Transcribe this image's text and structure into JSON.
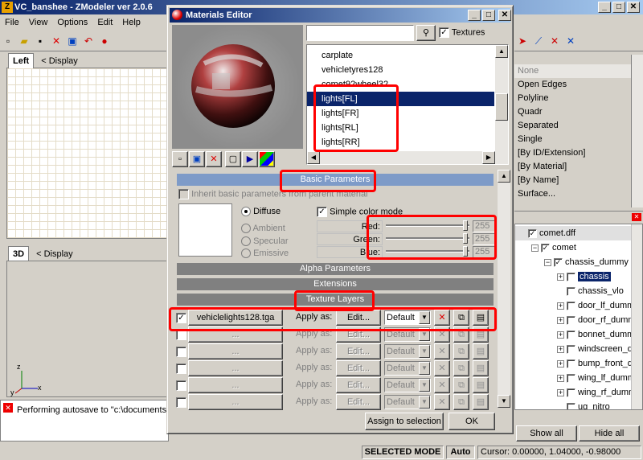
{
  "main_window": {
    "title": "VC_banshee - ZModeler ver 2.0.6",
    "app_icon": "Z"
  },
  "menu": [
    "File",
    "View",
    "Options",
    "Edit",
    "Help"
  ],
  "viewports": {
    "top": {
      "tab": "Left",
      "mode": "< Display"
    },
    "bottom": {
      "tab": "3D",
      "mode": "< Display"
    },
    "axis_z": "z",
    "axis_x": "x",
    "axis_y": "y"
  },
  "log": {
    "text": "Performing autosave to \"c:\\documents"
  },
  "dialog": {
    "title": "Materials Editor",
    "search_value": "",
    "textures_label": "Textures",
    "textures_checked": true,
    "materials": [
      {
        "name": "carplate",
        "selected": false
      },
      {
        "name": "vehicletyres128",
        "selected": false
      },
      {
        "name": "comet92wheel32",
        "selected": false
      },
      {
        "name": "lights[FL]",
        "selected": true
      },
      {
        "name": "lights[FR]",
        "selected": false
      },
      {
        "name": "lights[RL]",
        "selected": false
      },
      {
        "name": "lights[RR]",
        "selected": false
      }
    ],
    "basic_parameters": "Basic Parameters",
    "inherit_label": "Inherit basic parameters from parent material",
    "color_modes": {
      "diffuse": "Diffuse",
      "ambient": "Ambient",
      "specular": "Specular",
      "emissive": "Emissive"
    },
    "simple_color_mode": "Simple color mode",
    "channels": [
      {
        "label": "Red:",
        "value": "255"
      },
      {
        "label": "Green:",
        "value": "255"
      },
      {
        "label": "Blue:",
        "value": "255"
      }
    ],
    "alpha_parameters": "Alpha Parameters",
    "extensions": "Extensions",
    "texture_layers": "Texture Layers",
    "layers": [
      {
        "texture": "vehiclelights128.tga",
        "apply_as": "Apply as:",
        "edit": "Edit...",
        "mode": "Default",
        "enabled": true
      },
      {
        "texture": "...",
        "apply_as": "Apply as:",
        "edit": "Edit...",
        "mode": "Default",
        "enabled": false
      },
      {
        "texture": "...",
        "apply_as": "Apply as:",
        "edit": "Edit...",
        "mode": "Default",
        "enabled": false
      },
      {
        "texture": "...",
        "apply_as": "Apply as:",
        "edit": "Edit...",
        "mode": "Default",
        "enabled": false
      },
      {
        "texture": "...",
        "apply_as": "Apply as:",
        "edit": "Edit...",
        "mode": "Default",
        "enabled": false
      },
      {
        "texture": "...",
        "apply_as": "Apply as:",
        "edit": "Edit...",
        "mode": "Default",
        "enabled": false
      }
    ],
    "assign_button": "Assign to selection",
    "ok_button": "OK"
  },
  "selection_panel": {
    "items": [
      "None",
      "Open Edges",
      "Polyline",
      "Quadr",
      "Separated",
      "Single",
      "[By ID/Extension]",
      "[By Material]",
      "[By Name]",
      "Surface..."
    ]
  },
  "hierarchy": {
    "items": [
      {
        "label": "comet.dff",
        "indent": 0,
        "checked": true,
        "expander": "",
        "highlight": "root"
      },
      {
        "label": "comet",
        "indent": 1,
        "checked": true,
        "expander": "-",
        "highlight": ""
      },
      {
        "label": "chassis_dummy",
        "indent": 2,
        "checked": true,
        "expander": "-",
        "highlight": ""
      },
      {
        "label": "chassis",
        "indent": 3,
        "checked": false,
        "expander": "+",
        "highlight": "selected"
      },
      {
        "label": "chassis_vlo",
        "indent": 3,
        "checked": false,
        "expander": "",
        "highlight": ""
      },
      {
        "label": "door_lf_dummy",
        "indent": 3,
        "checked": false,
        "expander": "+",
        "highlight": ""
      },
      {
        "label": "door_rf_dummy",
        "indent": 3,
        "checked": false,
        "expander": "+",
        "highlight": ""
      },
      {
        "label": "bonnet_dummy",
        "indent": 3,
        "checked": false,
        "expander": "+",
        "highlight": ""
      },
      {
        "label": "windscreen_dummy",
        "indent": 3,
        "checked": false,
        "expander": "+",
        "highlight": ""
      },
      {
        "label": "bump_front_dummy",
        "indent": 3,
        "checked": false,
        "expander": "+",
        "highlight": ""
      },
      {
        "label": "wing_lf_dummy",
        "indent": 3,
        "checked": false,
        "expander": "+",
        "highlight": ""
      },
      {
        "label": "wing_rf_dummy",
        "indent": 3,
        "checked": false,
        "expander": "+",
        "highlight": ""
      },
      {
        "label": "ug_nitro",
        "indent": 3,
        "checked": false,
        "expander": "",
        "highlight": ""
      }
    ],
    "show_all": "Show all",
    "hide_all": "Hide all"
  },
  "status": {
    "mode": "SELECTED MODE",
    "auto": "Auto",
    "cursor": "Cursor: 0.00000, 1.04000, -0.98000"
  }
}
